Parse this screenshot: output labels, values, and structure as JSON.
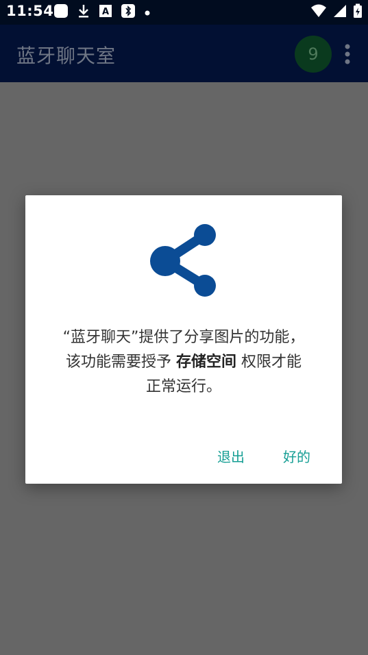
{
  "status_bar": {
    "time": "11:54",
    "left_icons": [
      "app-square-icon",
      "download-icon",
      "a-text-icon",
      "bluetooth-icon",
      "dot-icon"
    ],
    "right_icons": [
      "wifi-icon",
      "signal-icon",
      "battery-charging-icon"
    ]
  },
  "app_bar": {
    "title": "蓝牙聊天室",
    "badge_count": "9",
    "badge_color": "#0A3A1E",
    "background": "#021033"
  },
  "dialog": {
    "icon": "share-icon",
    "icon_color": "#0B4C95",
    "message_part1": "“蓝牙聊天”提供了分享图片的功能，",
    "message_part2": "该功能需要授予 ",
    "message_bold": "存储空间",
    "message_part3": " 权限才能",
    "message_part4": "正常运行。",
    "button_exit": "退出",
    "button_ok": "好的",
    "button_color": "#159E94"
  }
}
